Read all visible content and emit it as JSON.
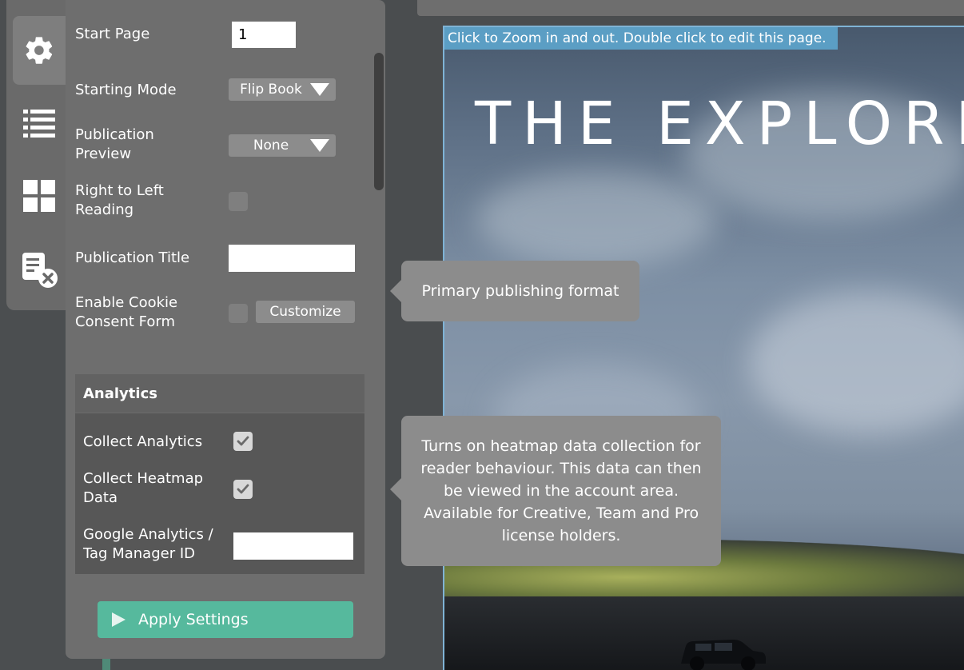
{
  "settings": {
    "start_page_label": "Start Page",
    "start_page_value": "1",
    "starting_mode_label": "Starting Mode",
    "starting_mode_value": "Flip Book",
    "publication_preview_label": "Publication Preview",
    "publication_preview_value": "None",
    "rtl_label": "Right to Left Reading",
    "publication_title_label": "Publication Title",
    "publication_title_value": "",
    "cookie_label": "Enable Cookie Consent Form",
    "customize_label": "Customize"
  },
  "analytics": {
    "heading": "Analytics",
    "collect_analytics_label": "Collect Analytics",
    "collect_analytics_checked": true,
    "collect_heatmap_label": "Collect Heatmap Data",
    "collect_heatmap_checked": true,
    "ga_label": "Google Analytics / Tag Manager ID",
    "ga_value": ""
  },
  "apply_label": "Apply Settings",
  "tooltips": {
    "primary_format": "Primary publishing format",
    "heatmap": "Turns on heatmap data collection for reader behaviour. This data can then be viewed in the account area. Available for Creative, Team and Pro license holders."
  },
  "preview": {
    "zoom_note": "Click to Zoom in and out. Double click to edit this page.",
    "cover_title": "THE EXPLORER"
  },
  "rail_icons": [
    "gear-icon",
    "list-icon",
    "grid-icon",
    "remove-document-icon"
  ],
  "colors": {
    "accent_green": "#56b99d",
    "panel_bg": "#6e6e6e",
    "tooltip_bg": "#8c8c8c",
    "zoom_note_bg": "#5b9ec4"
  }
}
